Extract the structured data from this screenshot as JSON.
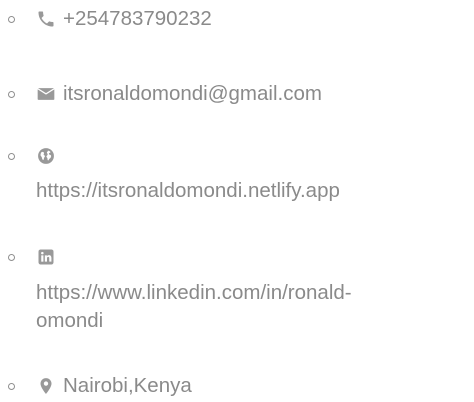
{
  "contacts": {
    "phone": {
      "icon": "phone-icon",
      "value": "+254783790232"
    },
    "email": {
      "icon": "envelope-icon",
      "value": "itsronaldomondi@gmail.com"
    },
    "website": {
      "icon": "globe-icon",
      "value": "https://itsronaldomondi.netlify.app"
    },
    "linkedin": {
      "icon": "linkedin-icon",
      "line1": "https://www.linkedin.com/in/ronald-",
      "line2": "omondi"
    },
    "location": {
      "icon": "map-marker-icon",
      "value": "Nairobi,Kenya"
    }
  },
  "colors": {
    "text": "#8a8a8a",
    "icon": "#999999",
    "bullet": "#8f8f8f",
    "background": "#ffffff"
  }
}
